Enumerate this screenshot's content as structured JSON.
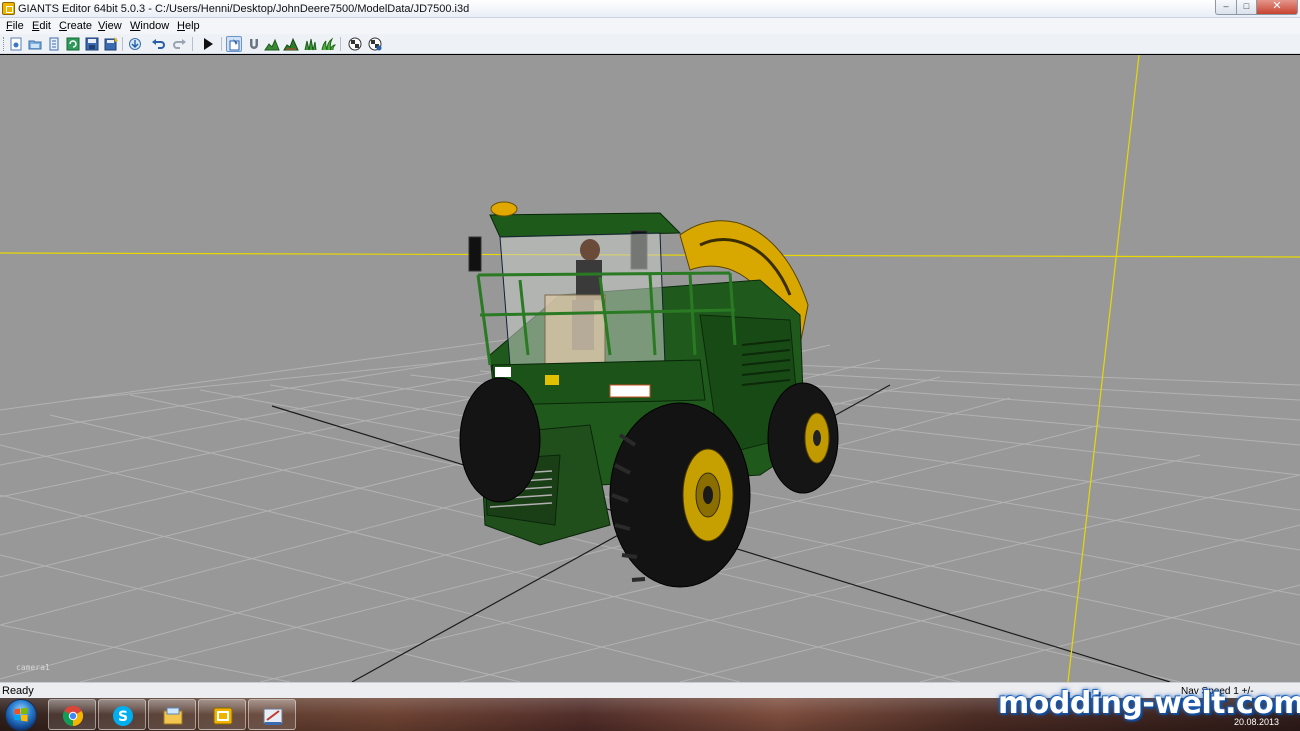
{
  "window": {
    "title": "GIANTS Editor 64bit 5.0.3 - C:/Users/Henni/Desktop/JohnDeere7500/ModelData/JD7500.i3d",
    "min_glyph": "–",
    "max_glyph": "□",
    "close_glyph": "✕"
  },
  "menu": {
    "items": [
      "File",
      "Edit",
      "Create",
      "View",
      "Window",
      "Help"
    ]
  },
  "toolbar": {
    "buttons": [
      "new-file-icon",
      "open-file-icon",
      "open-recent-icon",
      "refresh-icon",
      "save-icon",
      "save-as-icon",
      "import-icon",
      "undo-icon",
      "redo-icon",
      "play-icon",
      "select-mode-icon",
      "magnet-icon",
      "terrain-sculpt-icon",
      "terrain-paint-icon",
      "foliage-paint-icon",
      "foliage-grass-icon",
      "checker-icon",
      "checker-gear-icon"
    ]
  },
  "viewport": {
    "camera_label": "camera1",
    "background_color": "#989898",
    "grid_color": "#b4b4b4",
    "axis_color": "#e8d800"
  },
  "status": {
    "text": "Ready",
    "nav_speed": "Nav Speed 1 +/-"
  },
  "taskbar": {
    "apps": [
      "chrome-icon",
      "skype-icon",
      "file-explorer-icon",
      "giants-editor-icon",
      "screenshot-tool-icon"
    ],
    "watermark": "modding-welt.com",
    "date": "20.08.2013"
  }
}
